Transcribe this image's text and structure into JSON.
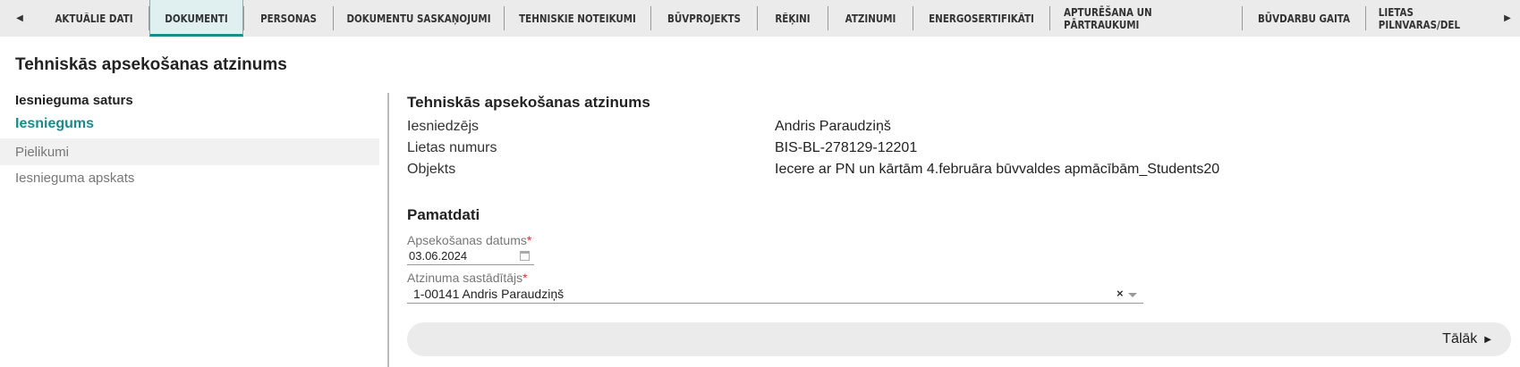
{
  "tabs": [
    {
      "label": "AKTUĀLIE DATI"
    },
    {
      "label": "DOKUMENTI"
    },
    {
      "label": "PERSONAS"
    },
    {
      "label": "DOKUMENTU SASKAŅOJUMI"
    },
    {
      "label": "TEHNISKIE NOTEIKUMI"
    },
    {
      "label": "BŪVPROJEKTS"
    },
    {
      "label": "RĒĶINI"
    },
    {
      "label": "ATZINUMI"
    },
    {
      "label": "ENERGOSERTIFIKĀTI"
    },
    {
      "label": "APTURĒŠANA UN PĀRTRAUKUMI"
    },
    {
      "label": "BŪVDARBU GAITA"
    },
    {
      "label": "LIETAS PILNVARAS/DEL"
    }
  ],
  "active_tab": "DOKUMENTI",
  "page_title": "Tehniskās apsekošanas atzinums",
  "nav": {
    "heading": "Iesnieguma saturs",
    "items": [
      {
        "label": "Iesniegums"
      },
      {
        "label": "Pielikumi"
      },
      {
        "label": "Iesnieguma apskats"
      }
    ]
  },
  "summary": {
    "title": "Tehniskās apsekošanas atzinums",
    "rows": [
      {
        "label": "Iesniedzējs",
        "value": "Andris Paraudziņš"
      },
      {
        "label": "Lietas numurs",
        "value": "BIS-BL-278129-12201"
      },
      {
        "label": "Objekts",
        "value": "Iecere ar PN un kārtām 4.februāra būvvaldes apmācībām_Students20"
      }
    ]
  },
  "form": {
    "title": "Pamatdati",
    "date_label": "Apsekošanas datums",
    "date_value": "03.06.2024",
    "author_label": "Atzinuma sastādītājs",
    "author_value": "1-00141 Andris Paraudziņš",
    "required_mark": "*"
  },
  "next_label": "Tālāk",
  "colors": {
    "accent": "#1b8a8a",
    "tabbar_bg": "#ebebeb",
    "active_tab_bg": "#e0f0f0",
    "required": "#c0392b"
  }
}
